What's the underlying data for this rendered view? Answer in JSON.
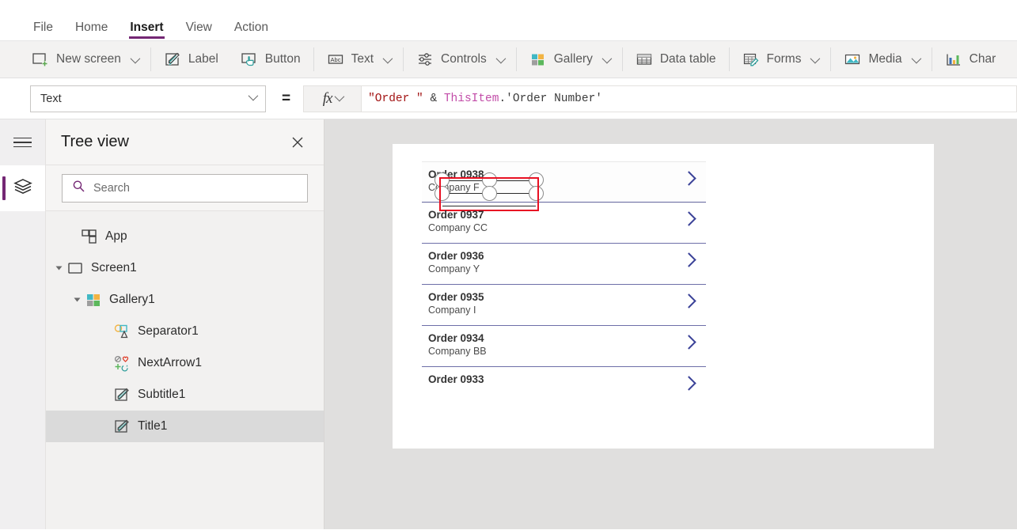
{
  "menu": {
    "items": [
      {
        "label": "File",
        "active": false
      },
      {
        "label": "Home",
        "active": false
      },
      {
        "label": "Insert",
        "active": true
      },
      {
        "label": "View",
        "active": false
      },
      {
        "label": "Action",
        "active": false
      }
    ]
  },
  "ribbon": {
    "items": [
      {
        "label": "New screen",
        "icon": "new-screen-icon",
        "caret": true
      },
      {
        "label": "Label",
        "icon": "label-icon",
        "caret": false
      },
      {
        "label": "Button",
        "icon": "button-icon",
        "caret": false
      },
      {
        "label": "Text",
        "icon": "text-abc-icon",
        "caret": true
      },
      {
        "label": "Controls",
        "icon": "controls-sliders-icon",
        "caret": true
      },
      {
        "label": "Gallery",
        "icon": "gallery-squares-icon",
        "caret": true
      },
      {
        "label": "Data table",
        "icon": "data-table-icon",
        "caret": false
      },
      {
        "label": "Forms",
        "icon": "forms-icon",
        "caret": true
      },
      {
        "label": "Media",
        "icon": "media-image-icon",
        "caret": true
      },
      {
        "label": "Char",
        "icon": "charts-bar-icon",
        "caret": false
      }
    ]
  },
  "formula_bar": {
    "property": "Text",
    "equals": "=",
    "fx_label": "fx",
    "formula_parts": [
      {
        "text": "\"Order \" ",
        "kind": "string"
      },
      {
        "text": "& ",
        "kind": "plain"
      },
      {
        "text": "ThisItem",
        "kind": "keyword"
      },
      {
        "text": ".'Order Number'",
        "kind": "plain"
      }
    ],
    "formula_full": "\"Order \" & ThisItem.'Order Number'"
  },
  "rail": {
    "hamburger": "menu-icon",
    "selected_tool": "tree-view-layers-icon"
  },
  "tree_panel": {
    "title": "Tree view",
    "close": "close-icon",
    "search": {
      "placeholder": "Search",
      "value": "",
      "icon": "search-icon"
    },
    "nodes": [
      {
        "label": "App",
        "indent": 0,
        "caret": false,
        "icon": "app-icon",
        "selected": false
      },
      {
        "label": "Screen1",
        "indent": 1,
        "caret": true,
        "icon": "screen-icon",
        "selected": false
      },
      {
        "label": "Gallery1",
        "indent": 2,
        "caret": true,
        "icon": "gallery-squares-icon",
        "selected": false
      },
      {
        "label": "Separator1",
        "indent": 3,
        "caret": false,
        "icon": "shapes-icon",
        "selected": false
      },
      {
        "label": "NextArrow1",
        "indent": 3,
        "caret": false,
        "icon": "icons-set-icon",
        "selected": false
      },
      {
        "label": "Subtitle1",
        "indent": 3,
        "caret": false,
        "icon": "label-icon",
        "selected": false
      },
      {
        "label": "Title1",
        "indent": 3,
        "caret": false,
        "icon": "label-icon",
        "selected": true
      }
    ]
  },
  "canvas": {
    "selected_control": "Title1",
    "selection_color": "#e81123",
    "gallery_rows": [
      {
        "title": "Order 0938",
        "subtitle": "Company F",
        "chevron": "chevron-right-icon",
        "selected": true
      },
      {
        "title": "Order 0937",
        "subtitle": "Company CC",
        "chevron": "chevron-right-icon",
        "selected": false
      },
      {
        "title": "Order 0936",
        "subtitle": "Company Y",
        "chevron": "chevron-right-icon",
        "selected": false
      },
      {
        "title": "Order 0935",
        "subtitle": "Company I",
        "chevron": "chevron-right-icon",
        "selected": false
      },
      {
        "title": "Order 0934",
        "subtitle": "Company BB",
        "chevron": "chevron-right-icon",
        "selected": false
      },
      {
        "title": "Order 0933",
        "subtitle": "",
        "chevron": "chevron-right-icon",
        "selected": false
      }
    ]
  },
  "colors": {
    "accent": "#742774",
    "selection": "#e81123",
    "divider": "#6d6fa8",
    "chevron": "#3b4298"
  }
}
